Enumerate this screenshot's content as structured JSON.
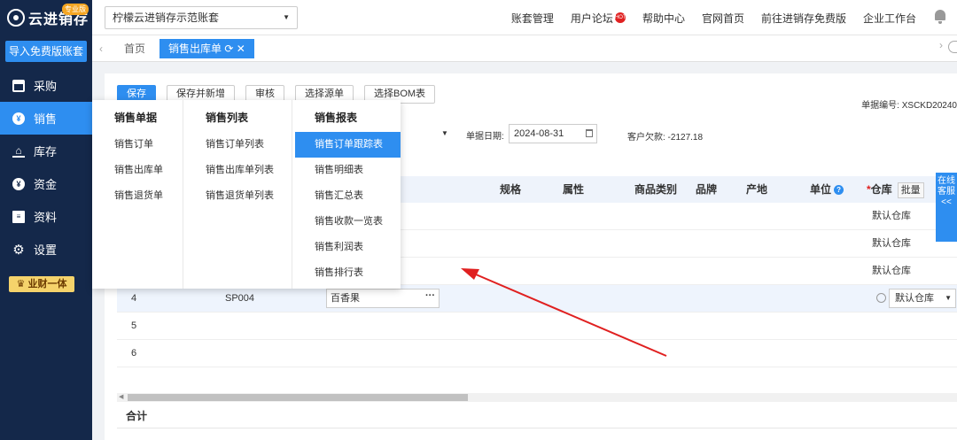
{
  "sidebar": {
    "logo_text": "云进销存",
    "logo_badge": "专业版",
    "import_button": "导入免费版账套",
    "items": [
      {
        "label": "采购"
      },
      {
        "label": "销售"
      },
      {
        "label": "库存"
      },
      {
        "label": "资金"
      },
      {
        "label": "资料"
      },
      {
        "label": "设置"
      }
    ],
    "promo_badge": "♛ 业财一体"
  },
  "topbar": {
    "account": "柠檬云进销存示范账套",
    "links": [
      "账套管理",
      "用户论坛",
      "帮助中心",
      "官网首页",
      "前往进销存免费版",
      "企业工作台"
    ],
    "hot_badge": "HOT"
  },
  "tabs": {
    "items": [
      "首页",
      "销售出库单"
    ],
    "active_index": 1
  },
  "toolbar": {
    "buttons": [
      "保存",
      "保存并新增",
      "审核",
      "选择源单",
      "选择BOM表"
    ]
  },
  "form": {
    "doc_number": "单据编号: XSCKD20240",
    "date_label": "单据日期:",
    "date_value": "2024-08-31",
    "debt": "客户欠款: -2127.18"
  },
  "grid": {
    "columns": [
      "规格",
      "属性",
      "商品类别",
      "品牌",
      "产地",
      "单位",
      "仓库",
      "批量"
    ],
    "rows": [
      {
        "no": "",
        "code": "",
        "name": "",
        "warehouse": "默认仓库"
      },
      {
        "no": "",
        "code": "",
        "name": "",
        "warehouse": "默认仓库"
      },
      {
        "no": "",
        "code": "",
        "name": "",
        "warehouse": "默认仓库"
      },
      {
        "no": "4",
        "code": "SP004",
        "name": "百香果",
        "warehouse": "默认仓库"
      },
      {
        "no": "5",
        "code": "",
        "name": "",
        "warehouse": ""
      },
      {
        "no": "6",
        "code": "",
        "name": "",
        "warehouse": ""
      }
    ],
    "total_label": "合计"
  },
  "menu": {
    "columns": [
      {
        "title": "销售单据",
        "items": [
          "销售订单",
          "销售出库单",
          "销售退货单"
        ]
      },
      {
        "title": "销售列表",
        "items": [
          "销售订单列表",
          "销售出库单列表",
          "销售退货单列表"
        ]
      },
      {
        "title": "销售报表",
        "items": [
          "销售订单跟踪表",
          "销售明细表",
          "销售汇总表",
          "销售收款一览表",
          "销售利润表",
          "销售排行表"
        ]
      }
    ],
    "active_item": "销售订单跟踪表"
  },
  "customer_service": "在线客服<<",
  "colors": {
    "sidebar_bg": "#14284a",
    "accent": "#2e8ef0",
    "arrow": "#e02020"
  }
}
